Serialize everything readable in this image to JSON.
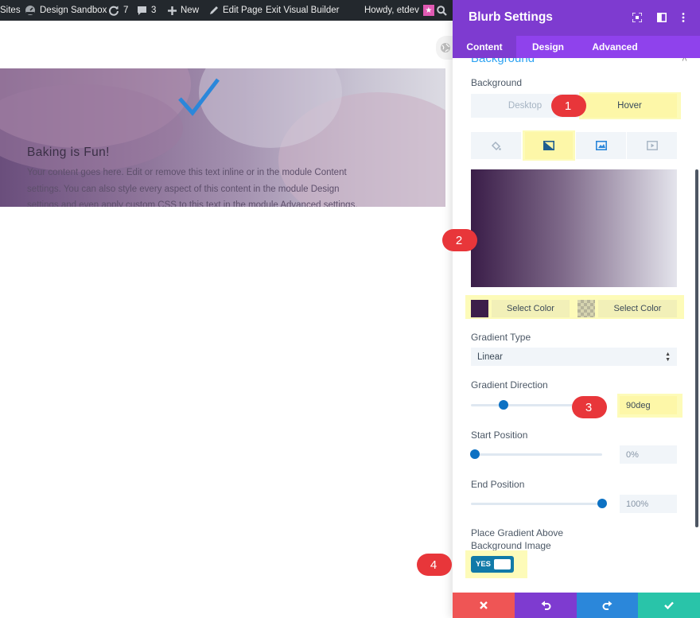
{
  "adminbar": {
    "sites": "Sites",
    "site_name": "Design Sandbox",
    "updates_count": "7",
    "comments_count": "3",
    "new_label": "New",
    "edit_page": "Edit Page",
    "exit_builder": "Exit Visual Builder",
    "howdy": "Howdy, etdev"
  },
  "hero": {
    "title": "Baking is Fun!",
    "body": "Your content goes here. Edit or remove this text inline or in the module Content settings. You can also style every aspect of this content in the module Design settings and even apply custom CSS to this text in the module Advanced settings."
  },
  "modal": {
    "title": "Blurb Settings",
    "tabs": [
      {
        "label": "Content",
        "active": true
      },
      {
        "label": "Design",
        "active": false
      },
      {
        "label": "Advanced",
        "active": false
      }
    ],
    "section_title": "Background",
    "background_label": "Background",
    "device_tabs": [
      {
        "label": "Desktop",
        "active": false
      },
      {
        "label": "Hover",
        "active": true
      }
    ],
    "bg_types": [
      {
        "icon": "paint-bucket-icon",
        "active": false
      },
      {
        "icon": "gradient-icon",
        "active": true
      },
      {
        "icon": "image-icon",
        "active": false
      },
      {
        "icon": "video-icon",
        "active": false
      }
    ],
    "gradient_preview": {
      "start_color": "#3a1d48",
      "end_color": "#e4e4ec"
    },
    "color_stops": [
      {
        "swatch": "#3d1f4a",
        "label": "Select Color"
      },
      {
        "swatch": "transparent",
        "label": "Select Color"
      }
    ],
    "gradient_type": {
      "label": "Gradient Type",
      "value": "Linear"
    },
    "gradient_direction": {
      "label": "Gradient Direction",
      "value": "90deg",
      "fraction": 0.25
    },
    "start_position": {
      "label": "Start Position",
      "value": "0%",
      "fraction": 0.0
    },
    "end_position": {
      "label": "End Position",
      "value": "100%",
      "fraction": 1.0
    },
    "place_gradient": {
      "label_line1": "Place Gradient Above",
      "label_line2": "Background Image",
      "toggle_label": "YES",
      "on": true
    }
  },
  "footer": {
    "buttons": [
      {
        "icon": "close-icon",
        "color": "#ef5555"
      },
      {
        "icon": "undo-icon",
        "color": "#7e3bd0"
      },
      {
        "icon": "redo-icon",
        "color": "#2b87da"
      },
      {
        "icon": "check-icon",
        "color": "#29c4a9"
      }
    ]
  },
  "callouts": [
    "1",
    "2",
    "3",
    "4"
  ],
  "colors": {
    "accent_purple": "#7e3bd0",
    "tab_purple": "#8f42ec",
    "highlight": "#fdfbb9",
    "link_blue": "#2ea3f2",
    "slider_blue": "#0c71c3"
  }
}
